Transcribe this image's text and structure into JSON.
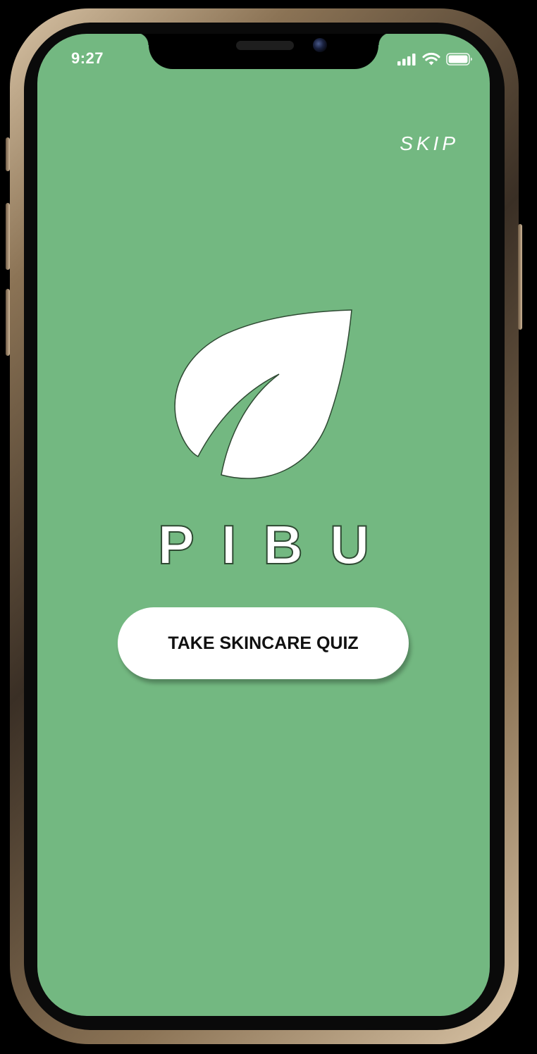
{
  "status_bar": {
    "time": "9:27",
    "icons": [
      "signal-icon",
      "wifi-icon",
      "battery-icon"
    ]
  },
  "header": {
    "skip_label": "SKIP"
  },
  "brand": {
    "logo_icon": "leaf-icon",
    "name": "PIBU"
  },
  "actions": {
    "quiz_button_label": "TAKE SKINCARE QUIZ"
  },
  "colors": {
    "screen_background": "#73b881",
    "button_background": "#ffffff",
    "text_light": "#ffffff",
    "leaf_outline": "#2f4a33"
  }
}
